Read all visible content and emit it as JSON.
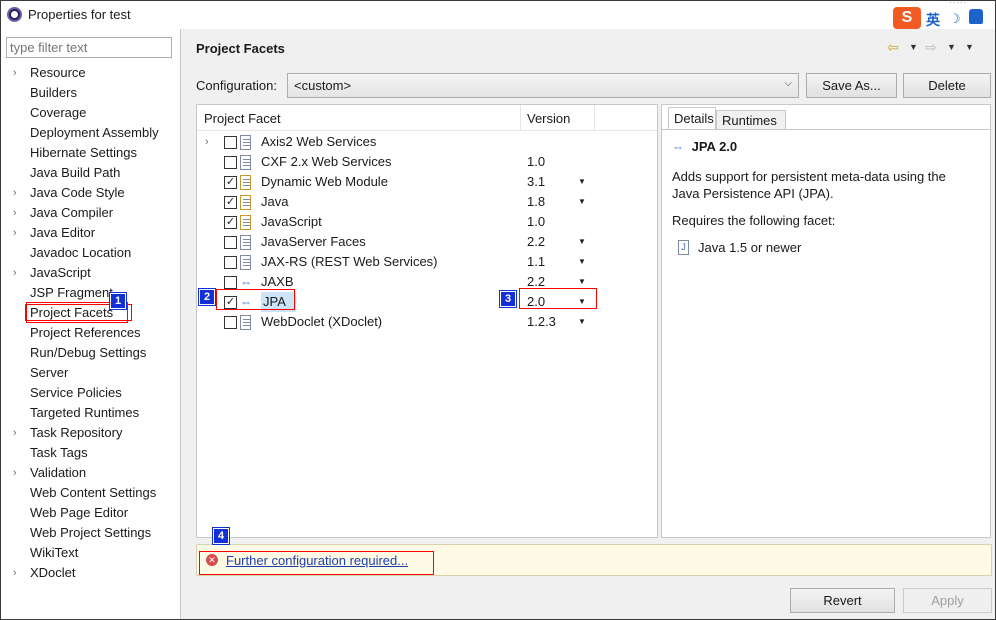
{
  "window": {
    "title": "Properties for test"
  },
  "ime": {
    "brand": "S",
    "mode": "英"
  },
  "filter": {
    "placeholder": "type filter text"
  },
  "tree": [
    {
      "label": "Resource",
      "expandable": true
    },
    {
      "label": "Builders",
      "expandable": false
    },
    {
      "label": "Coverage",
      "expandable": false
    },
    {
      "label": "Deployment Assembly",
      "expandable": false
    },
    {
      "label": "Hibernate Settings",
      "expandable": false
    },
    {
      "label": "Java Build Path",
      "expandable": false
    },
    {
      "label": "Java Code Style",
      "expandable": true
    },
    {
      "label": "Java Compiler",
      "expandable": true
    },
    {
      "label": "Java Editor",
      "expandable": true
    },
    {
      "label": "Javadoc Location",
      "expandable": false
    },
    {
      "label": "JavaScript",
      "expandable": true
    },
    {
      "label": "JSP Fragment",
      "expandable": false
    },
    {
      "label": "Project Facets",
      "expandable": false,
      "selected": true
    },
    {
      "label": "Project References",
      "expandable": false
    },
    {
      "label": "Run/Debug Settings",
      "expandable": false
    },
    {
      "label": "Server",
      "expandable": false
    },
    {
      "label": "Service Policies",
      "expandable": false
    },
    {
      "label": "Targeted Runtimes",
      "expandable": false
    },
    {
      "label": "Task Repository",
      "expandable": true
    },
    {
      "label": "Task Tags",
      "expandable": false
    },
    {
      "label": "Validation",
      "expandable": true
    },
    {
      "label": "Web Content Settings",
      "expandable": false
    },
    {
      "label": "Web Page Editor",
      "expandable": false
    },
    {
      "label": "Web Project Settings",
      "expandable": false
    },
    {
      "label": "WikiText",
      "expandable": false
    },
    {
      "label": "XDoclet",
      "expandable": true
    }
  ],
  "page": {
    "title": "Project Facets"
  },
  "config": {
    "label": "Configuration:",
    "value": "<custom>",
    "save_as": "Save As...",
    "delete": "Delete"
  },
  "facets": {
    "col_facet": "Project Facet",
    "col_version": "Version",
    "rows": [
      {
        "name": "Axis2 Web Services",
        "version": "",
        "checked": false,
        "expandable": true,
        "dropdown": false,
        "icon": "doc-icon"
      },
      {
        "name": "CXF 2.x Web Services",
        "version": "1.0",
        "checked": false,
        "expandable": false,
        "dropdown": false,
        "icon": "doc-icon"
      },
      {
        "name": "Dynamic Web Module",
        "version": "3.1",
        "checked": true,
        "expandable": false,
        "dropdown": true,
        "icon": "lock-doc-icon"
      },
      {
        "name": "Java",
        "version": "1.8",
        "checked": true,
        "expandable": false,
        "dropdown": true,
        "icon": "lock-doc-icon"
      },
      {
        "name": "JavaScript",
        "version": "1.0",
        "checked": true,
        "expandable": false,
        "dropdown": false,
        "icon": "lock-doc-icon"
      },
      {
        "name": "JavaServer Faces",
        "version": "2.2",
        "checked": false,
        "expandable": false,
        "dropdown": true,
        "icon": "doc-icon"
      },
      {
        "name": "JAX-RS (REST Web Services)",
        "version": "1.1",
        "checked": false,
        "expandable": false,
        "dropdown": true,
        "icon": "doc-icon"
      },
      {
        "name": "JAXB",
        "version": "2.2",
        "checked": false,
        "expandable": false,
        "dropdown": true,
        "icon": "arrows-icon"
      },
      {
        "name": "JPA",
        "version": "2.0",
        "checked": true,
        "expandable": false,
        "dropdown": true,
        "icon": "arrows-icon",
        "highlight": true
      },
      {
        "name": "WebDoclet (XDoclet)",
        "version": "1.2.3",
        "checked": false,
        "expandable": false,
        "dropdown": true,
        "icon": "doc-icon"
      }
    ]
  },
  "details": {
    "tab_details": "Details",
    "tab_runtimes": "Runtimes",
    "title": "JPA 2.0",
    "description": "Adds support for persistent meta-data using the Java Persistence API (JPA).",
    "requires": "Requires the following facet:",
    "required_item": "Java 1.5 or newer"
  },
  "warning": {
    "link": "Further configuration required..."
  },
  "buttons": {
    "revert": "Revert",
    "apply": "Apply"
  },
  "markers": [
    "1",
    "2",
    "3",
    "4"
  ],
  "colors": {
    "marker": "#1230d8",
    "highlight_box": "#ff0000",
    "warning_bg": "#fffae5",
    "link": "#1b3fb0"
  }
}
